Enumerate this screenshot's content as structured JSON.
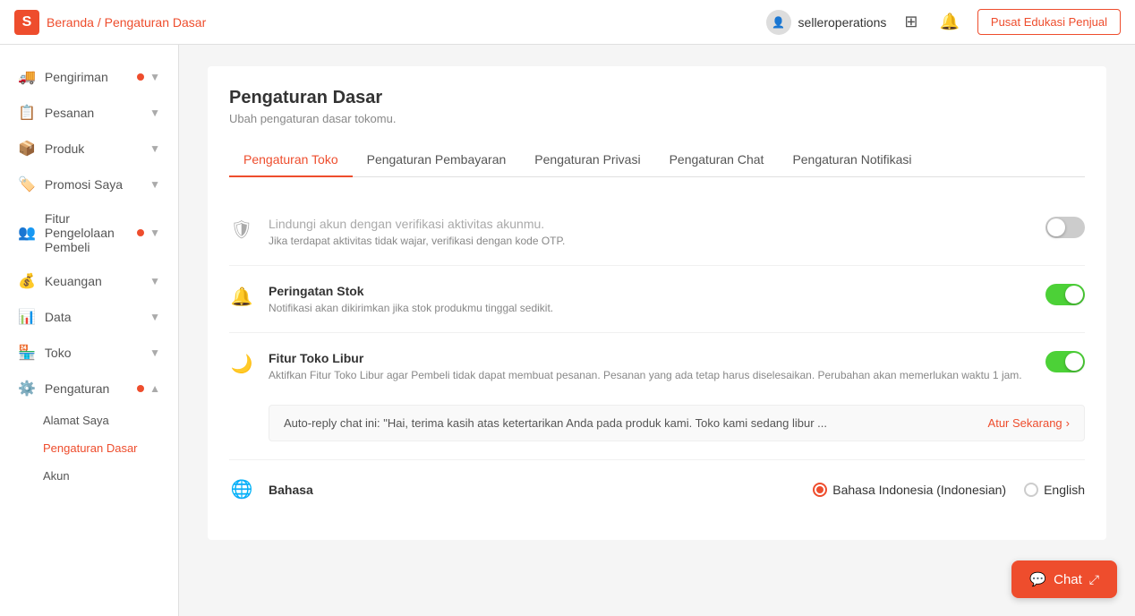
{
  "nav": {
    "logo_text": "S",
    "breadcrumb_home": "Beranda",
    "breadcrumb_sep": "/",
    "breadcrumb_current": "Pengaturan Dasar",
    "username": "selleroperations",
    "edu_btn_label": "Pusat Edukasi Penjual"
  },
  "sidebar": {
    "items": [
      {
        "id": "pengiriman",
        "label": "Pengiriman",
        "icon": "🚚",
        "has_dot": true,
        "has_chevron": true
      },
      {
        "id": "pesanan",
        "label": "Pesanan",
        "icon": "📋",
        "has_dot": false,
        "has_chevron": true
      },
      {
        "id": "produk",
        "label": "Produk",
        "icon": "📦",
        "has_dot": false,
        "has_chevron": true
      },
      {
        "id": "promosi",
        "label": "Promosi Saya",
        "icon": "🏷️",
        "has_dot": false,
        "has_chevron": true
      },
      {
        "id": "fitur",
        "label": "Fitur Pengelolaan Pembeli",
        "icon": "👥",
        "has_dot": true,
        "has_chevron": true
      },
      {
        "id": "keuangan",
        "label": "Keuangan",
        "icon": "💰",
        "has_dot": false,
        "has_chevron": true
      },
      {
        "id": "data",
        "label": "Data",
        "icon": "📊",
        "has_dot": false,
        "has_chevron": true
      },
      {
        "id": "toko",
        "label": "Toko",
        "icon": "🏪",
        "has_dot": false,
        "has_chevron": true
      },
      {
        "id": "pengaturan",
        "label": "Pengaturan",
        "icon": "⚙️",
        "has_dot": true,
        "has_chevron": true,
        "expanded": true
      }
    ],
    "sub_items": [
      {
        "id": "alamat",
        "label": "Alamat Saya",
        "active": false
      },
      {
        "id": "pengaturan-dasar",
        "label": "Pengaturan Dasar",
        "active": true
      },
      {
        "id": "akun",
        "label": "Akun",
        "active": false
      }
    ]
  },
  "page": {
    "title": "Pengaturan Dasar",
    "subtitle": "Ubah pengaturan dasar tokomu."
  },
  "tabs": [
    {
      "id": "toko",
      "label": "Pengaturan Toko",
      "active": true
    },
    {
      "id": "pembayaran",
      "label": "Pengaturan Pembayaran",
      "active": false
    },
    {
      "id": "privasi",
      "label": "Pengaturan Privasi",
      "active": false
    },
    {
      "id": "chat",
      "label": "Pengaturan Chat",
      "active": false
    },
    {
      "id": "notifikasi",
      "label": "Pengaturan Notifikasi",
      "active": false
    }
  ],
  "settings": [
    {
      "id": "verifikasi",
      "icon": "🛡",
      "title": "Lindungi akun dengan verifikasi aktivitas akunmu.",
      "title_muted": true,
      "desc": "Jika terdapat aktivitas tidak wajar, verifikasi dengan kode OTP.",
      "toggle": false,
      "has_toggle": true
    },
    {
      "id": "stok",
      "icon": "🔔",
      "title": "Peringatan Stok",
      "title_muted": false,
      "desc": "Notifikasi akan dikirimkan jika stok produkmu tinggal sedikit.",
      "toggle": true,
      "has_toggle": true
    },
    {
      "id": "libur",
      "icon": "🌙",
      "title": "Fitur Toko Libur",
      "title_muted": false,
      "desc": "Aktifkan Fitur Toko Libur agar Pembeli tidak dapat membuat pesanan. Pesanan yang ada tetap harus diselesaikan. Perubahan akan memerlukan waktu 1 jam.",
      "toggle": true,
      "has_toggle": true,
      "has_auto_reply": true,
      "auto_reply_text": "Auto-reply chat ini: \"Hai, terima kasih atas ketertarikan Anda pada produk kami. Toko kami sedang libur ...",
      "auto_reply_link": "Atur Sekarang"
    }
  ],
  "language": {
    "label": "Bahasa",
    "options": [
      {
        "id": "id",
        "label": "Bahasa Indonesia (Indonesian)",
        "selected": true
      },
      {
        "id": "en",
        "label": "English",
        "selected": false
      }
    ]
  },
  "chat_btn": {
    "label": "Chat"
  }
}
